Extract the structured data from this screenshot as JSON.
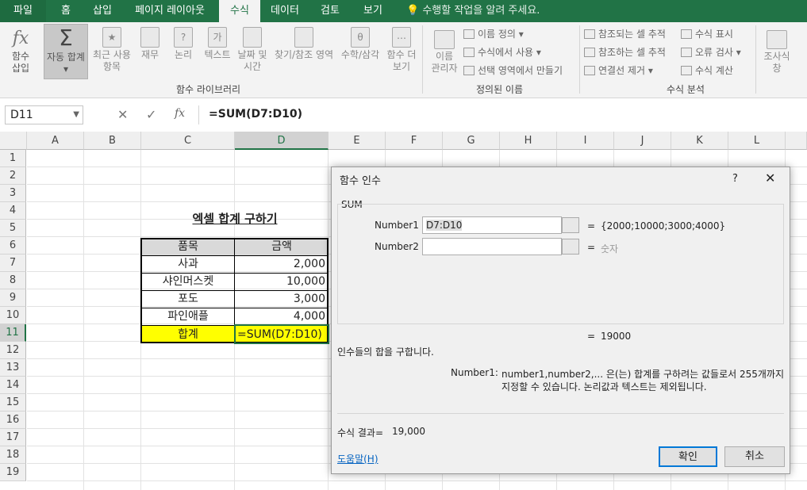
{
  "tabs": [
    "파일",
    "홈",
    "삽입",
    "페이지 레이아웃",
    "수식",
    "데이터",
    "검토",
    "보기"
  ],
  "active_tab": "수식",
  "tell_me": "수행할 작업을 알려 주세요.",
  "ribbon": {
    "insert_fn": [
      "함수",
      "삽입"
    ],
    "autosum": [
      "자동 합계"
    ],
    "recent": [
      "최근 사용",
      "항목"
    ],
    "finance": [
      "재무"
    ],
    "logic": [
      "논리"
    ],
    "text": [
      "텍스트"
    ],
    "datetime": [
      "날짜 및",
      "시간"
    ],
    "lookup": [
      "찾기/참조 영역"
    ],
    "math": [
      "수학/삼각"
    ],
    "more": [
      "함수 더",
      "보기"
    ],
    "group_library": "함수 라이브러리",
    "name_mgr": [
      "이름",
      "관리자"
    ],
    "define_name": "이름 정의",
    "use_in_formula": "수식에서 사용",
    "create_from_sel": "선택 영역에서 만들기",
    "group_names": "정의된 이름",
    "trace_prec": "참조되는 셀 추적",
    "trace_dep": "참조하는 셀 추적",
    "remove_arrows": "연결선 제거",
    "show_formulas": "수식 표시",
    "error_check": "오류 검사",
    "eval_formula": "수식 계산",
    "group_audit": "수식 분석",
    "watch": [
      "조사식",
      "창"
    ]
  },
  "formula_bar": {
    "name_box": "D11",
    "formula": "=SUM(D7:D10)"
  },
  "columns": [
    "A",
    "B",
    "C",
    "D",
    "E",
    "F",
    "G",
    "H",
    "I",
    "J",
    "K",
    "L"
  ],
  "rows": [
    "1",
    "2",
    "3",
    "4",
    "5",
    "6",
    "7",
    "8",
    "9",
    "10",
    "11",
    "12",
    "13",
    "14",
    "15",
    "16",
    "17",
    "18",
    "19"
  ],
  "sheet": {
    "title": "엑셀 합계 구하기",
    "header": [
      "품목",
      "금액"
    ],
    "items": [
      [
        "사과",
        "2,000"
      ],
      [
        "샤인머스켓",
        "10,000"
      ],
      [
        "포도",
        "3,000"
      ],
      [
        "파인애플",
        "4,000"
      ]
    ],
    "total_label": "합계",
    "total_formula": "=SUM(D7:D10)"
  },
  "dialog": {
    "title": "함수 인수",
    "help_q": "?",
    "func": "SUM",
    "arg1_label": "Number1",
    "arg1_value": "D7:D10",
    "arg1_result": "{2000;10000;3000;4000}",
    "arg2_label": "Number2",
    "arg2_hint": "숫자",
    "eq": "=",
    "preview_result": "19000",
    "description": "인수들의 합을 구합니다.",
    "arg_help_label": "Number1:",
    "arg_help_line1": "number1,number2,... 은(는) 합계를 구하려는 값들로서 255개까지",
    "arg_help_line2": "지정할 수 있습니다. 논리값과 텍스트는 제외됩니다.",
    "formula_result_label": "수식 결과=",
    "formula_result": "19,000",
    "help_link": "도움말(H)",
    "ok": "확인",
    "cancel": "취소"
  },
  "colors": {
    "brand": "#217346",
    "highlight": "#ffff00",
    "header_fill": "#d9d9d9"
  }
}
